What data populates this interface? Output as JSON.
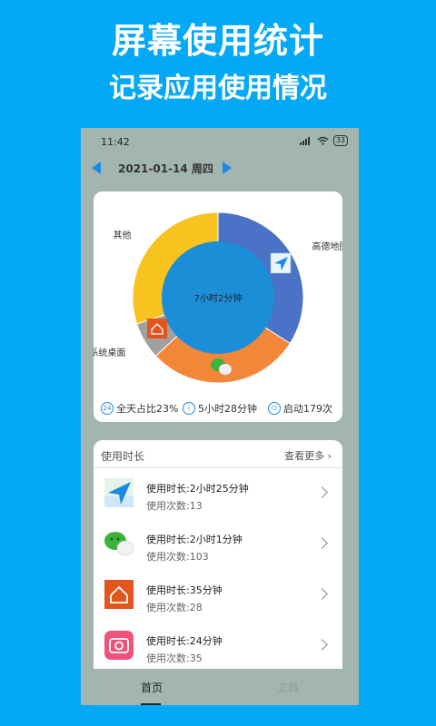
{
  "promo": {
    "title": "屏幕使用统计",
    "subtitle": "记录应用使用情况"
  },
  "status": {
    "time": "11:42",
    "battery": "33"
  },
  "datebar": {
    "date": "2021-01-14 周四"
  },
  "chart_data": {
    "type": "pie",
    "center_label": "7小时2分钟",
    "categories": [
      "高德地图",
      "微信",
      "系统桌面",
      "其他"
    ],
    "values": [
      34,
      29,
      7,
      30
    ],
    "colors": [
      "#4A72C6",
      "#F2873A",
      "#A0A0A0",
      "#F8C31E"
    ],
    "hole_color": "#1C8ED8"
  },
  "stats": {
    "share": "全天占比23%",
    "duration": "5小时28分钟",
    "launches": "启动179次"
  },
  "usage": {
    "title": "使用时长",
    "more": "查看更多",
    "items": [
      {
        "duration": "使用时长:2小时25分钟",
        "count": "使用次数:13",
        "icon": "amap-icon"
      },
      {
        "duration": "使用时长:2小时1分钟",
        "count": "使用次数:103",
        "icon": "wechat-icon"
      },
      {
        "duration": "使用时长:35分钟",
        "count": "使用次数:28",
        "icon": "home-launcher-icon"
      },
      {
        "duration": "使用时长:24分钟",
        "count": "使用次数:35",
        "icon": "camera-icon"
      }
    ]
  },
  "tabs": {
    "home": "首页",
    "tools": "工具"
  }
}
